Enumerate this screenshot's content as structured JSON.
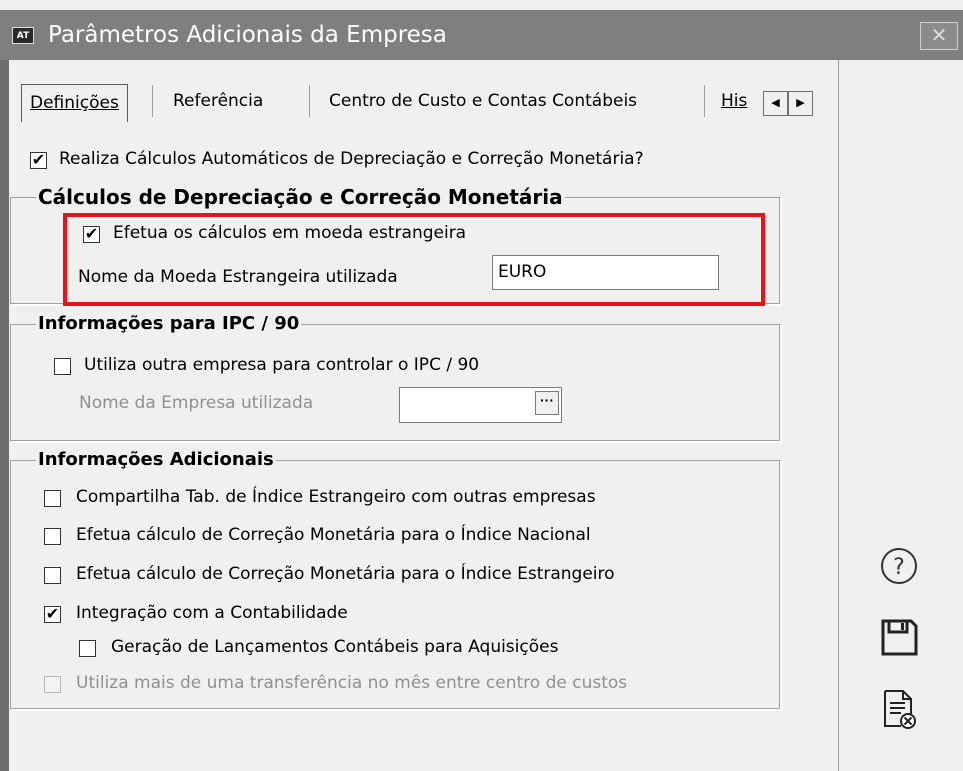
{
  "window": {
    "title": "Parâmetros Adicionais da Empresa",
    "app_icon_text": "AT",
    "close_glyph": "✕"
  },
  "tabs": [
    {
      "label": "Definições",
      "active": true
    },
    {
      "label": "Referência",
      "active": false
    },
    {
      "label": "Centro de Custo e Contas Contábeis",
      "active": false
    },
    {
      "label": "His",
      "active": false
    }
  ],
  "tab_scroll": {
    "left": "◀",
    "right": "▶"
  },
  "main": {
    "auto_calc": {
      "label": "Realiza Cálculos Automáticos de Depreciação e Correção Monetária?",
      "checked": true,
      "glyph": "✔"
    }
  },
  "group_depreciation": {
    "title": "Cálculos de Depreciação e Correção Monetária",
    "foreign_currency": {
      "label": "Efetua os cálculos em moeda estrangeira",
      "checked": true,
      "glyph": "✔"
    },
    "currency_name_label": "Nome da Moeda Estrangeira utilizada",
    "currency_name_value": "EURO"
  },
  "group_ipc": {
    "title": "Informações para IPC / 90",
    "other_company": {
      "label": "Utiliza outra empresa para controlar o IPC / 90",
      "checked": false
    },
    "company_name_label": "Nome da Empresa utilizada",
    "company_name_value": "",
    "lookup_glyph": "···"
  },
  "group_additional": {
    "title": "Informações Adicionais",
    "items": [
      {
        "label": "Compartilha Tab. de Índice Estrangeiro com outras empresas",
        "checked": false,
        "enabled": true
      },
      {
        "label": "Efetua cálculo de Correção  Monetária para o Índice Nacional",
        "checked": false,
        "enabled": true
      },
      {
        "label": "Efetua cálculo de Correção Monetária para o Índice  Estrangeiro",
        "checked": false,
        "enabled": true
      },
      {
        "label": "Integração com a Contabilidade",
        "checked": true,
        "enabled": true,
        "glyph": "✔"
      },
      {
        "label": "Geração de Lançamentos Contábeis para  Aquisições",
        "checked": false,
        "enabled": true
      },
      {
        "label": "Utiliza mais de uma transferência no mês entre centro de custos",
        "checked": false,
        "enabled": false
      }
    ]
  },
  "side_buttons": [
    {
      "name": "help-icon"
    },
    {
      "name": "save-icon"
    },
    {
      "name": "cancel-document-icon"
    }
  ],
  "colors": {
    "highlight": "#e8141c",
    "titlebar": "#7f7f7f"
  }
}
